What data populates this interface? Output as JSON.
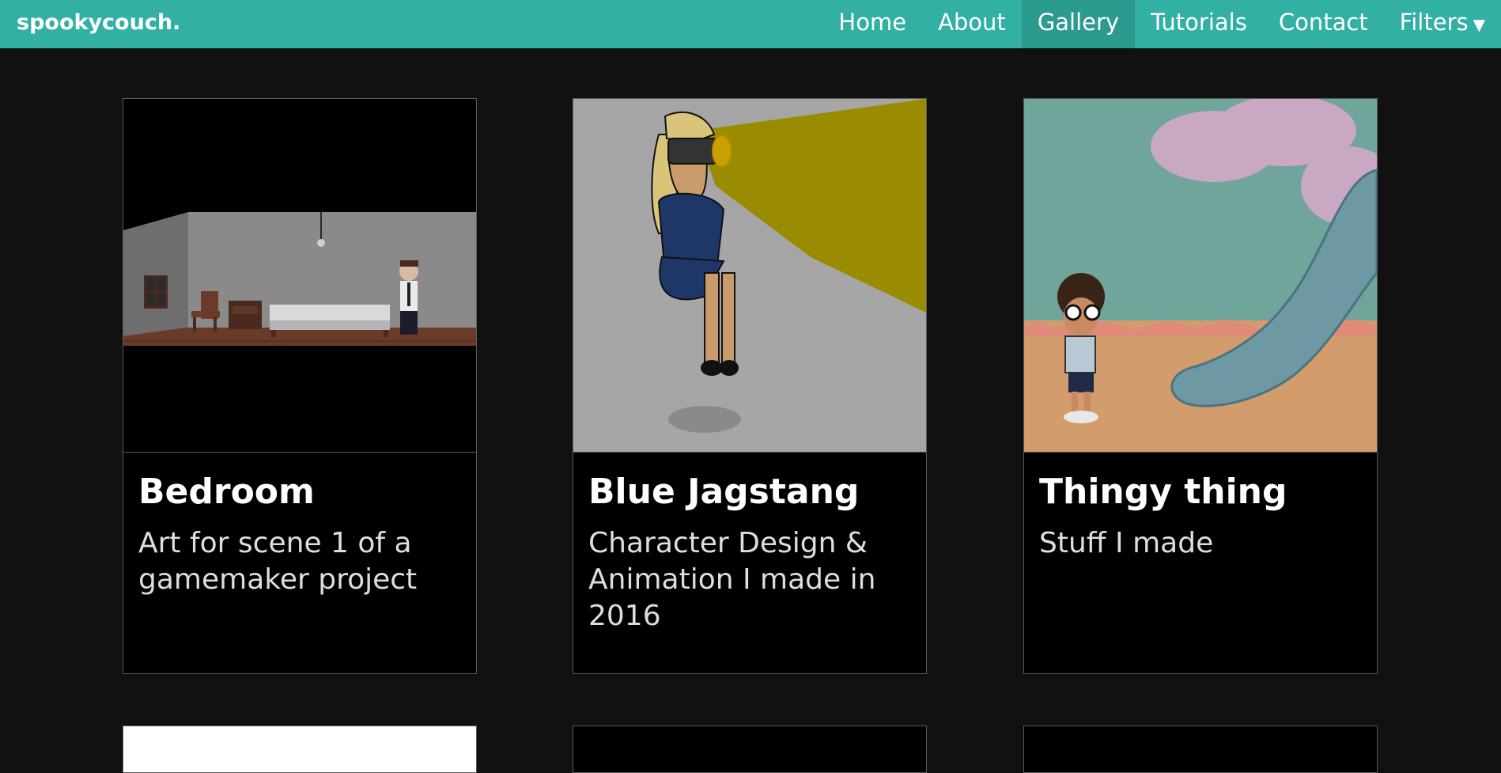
{
  "brand": "spookycouch.",
  "nav": {
    "items": [
      {
        "label": "Home"
      },
      {
        "label": "About"
      },
      {
        "label": "Gallery"
      },
      {
        "label": "Tutorials"
      },
      {
        "label": "Contact"
      },
      {
        "label": "Filters"
      }
    ],
    "active": "Gallery",
    "filters_caret": "▼"
  },
  "colors": {
    "accent": "#32b0a4",
    "accent_active": "#2b9a8f",
    "background": "#111111",
    "card_background": "#000000"
  },
  "cards": [
    {
      "title": "Bedroom",
      "description": "Art for scene 1 of a gamemaker project"
    },
    {
      "title": "Blue Jagstang",
      "description": "Character Design & Animation I made in 2016"
    },
    {
      "title": "Thingy thing",
      "description": "Stuff I made"
    }
  ]
}
